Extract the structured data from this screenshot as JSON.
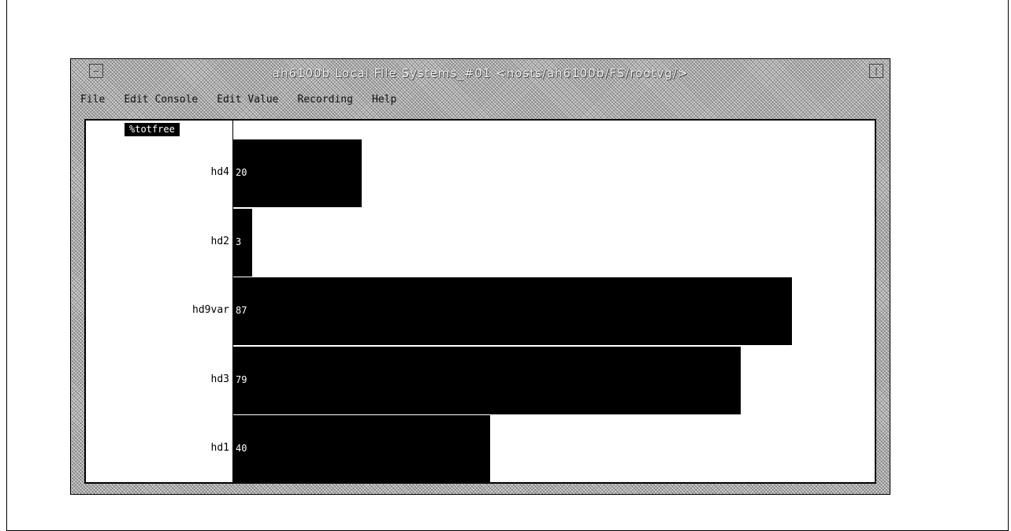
{
  "window": {
    "title": "ah6100b Local File Systems_#01 <hosts/ah6100b/FS/rootvg/>"
  },
  "menubar": {
    "items": [
      "File",
      "Edit Console",
      "Edit Value",
      "Recording",
      "Help"
    ]
  },
  "column_header": "%totfree",
  "rows": [
    {
      "label": "hd4",
      "value_text": "20",
      "fraction": 0.2
    },
    {
      "label": "hd2",
      "value_text": "3",
      "fraction": 0.03
    },
    {
      "label": "hd9var",
      "value_text": "87",
      "fraction": 0.87
    },
    {
      "label": "hd3",
      "value_text": "79",
      "fraction": 0.79
    },
    {
      "label": "hd1",
      "value_text": "40",
      "fraction": 0.4
    }
  ]
}
